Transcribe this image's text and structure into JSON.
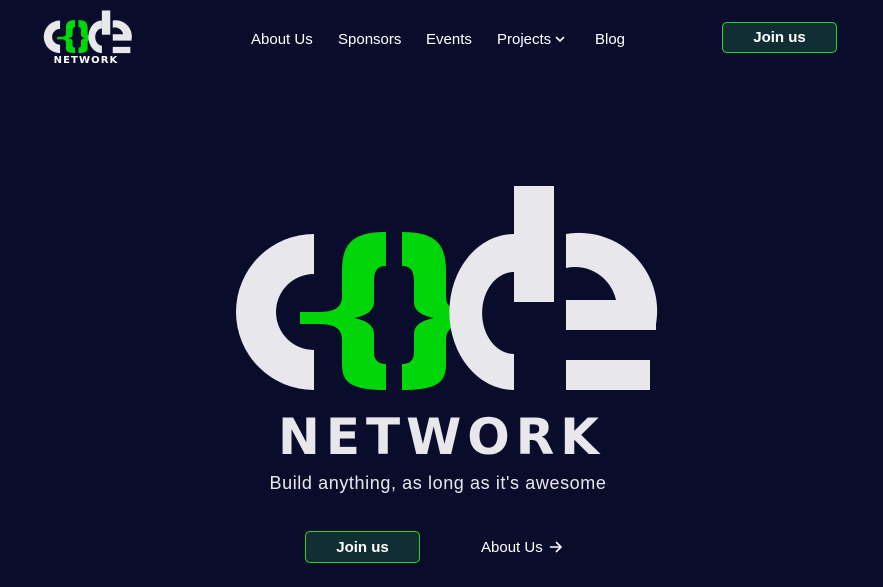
{
  "brand": {
    "name": "code",
    "caption": "NETWORK",
    "colors": {
      "light": "#e8e8ec",
      "accent": "#00d60a",
      "background": "#0a0c2c",
      "button_bg": "#102e34",
      "button_border": "#2ed51f"
    }
  },
  "nav": {
    "items": [
      {
        "label": "About Us"
      },
      {
        "label": "Sponsors"
      },
      {
        "label": "Events"
      },
      {
        "label": "Projects",
        "icon": "chevron-down-icon"
      },
      {
        "label": "Blog"
      }
    ],
    "join_label": "Join us"
  },
  "hero": {
    "logo_text": "code",
    "title": "NETWORK",
    "tagline": "Build anything, as long as it's awesome",
    "primary_cta": "Join us",
    "secondary_cta": "About Us",
    "secondary_icon": "arrow-right-icon"
  }
}
